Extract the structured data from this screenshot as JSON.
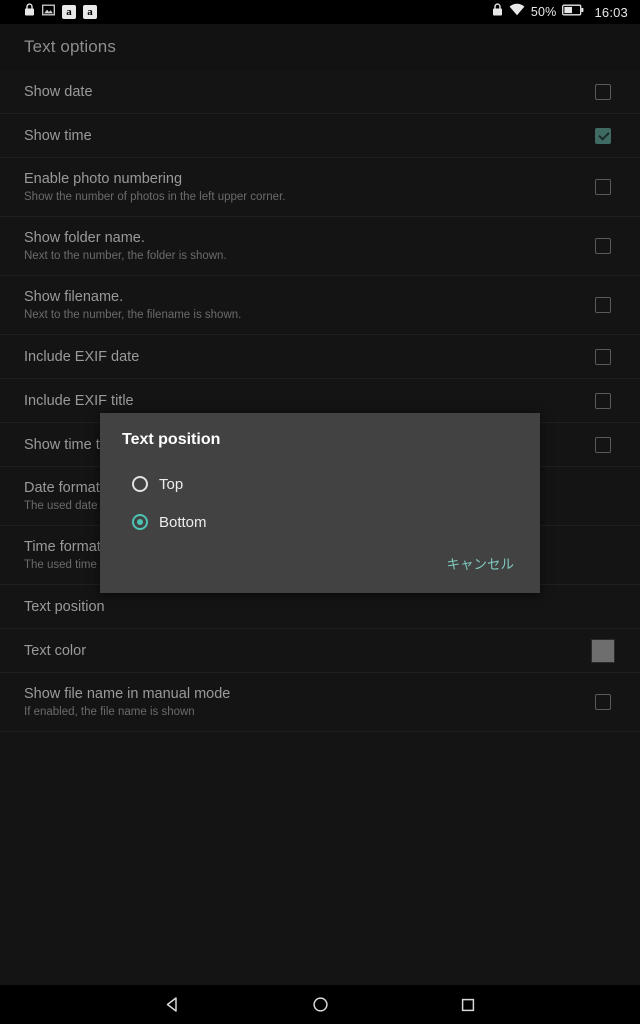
{
  "status_bar": {
    "left_icons": [
      "lock-icon",
      "image-icon",
      "amazon-icon",
      "amazon-icon"
    ],
    "amazon_glyph": "a",
    "right": {
      "lock_icon": "lock-icon",
      "wifi_icon": "wifi-icon",
      "battery_percent": "50%",
      "battery_icon": "battery-half-icon",
      "clock": "16:03"
    }
  },
  "toolbar": {
    "title": "Text options"
  },
  "preferences": [
    {
      "title": "Show date",
      "summary": "",
      "widget": "checkbox",
      "checked": false
    },
    {
      "title": "Show time",
      "summary": "",
      "widget": "checkbox",
      "checked": true
    },
    {
      "title": "Enable photo numbering",
      "summary": "Show the number of photos in the left upper corner.",
      "widget": "checkbox",
      "checked": false
    },
    {
      "title": "Show folder name.",
      "summary": "Next to the number, the folder is shown.",
      "widget": "checkbox",
      "checked": false
    },
    {
      "title": "Show filename.",
      "summary": "Next to the number, the filename is shown.",
      "widget": "checkbox",
      "checked": false
    },
    {
      "title": "Include EXIF date",
      "summary": "",
      "widget": "checkbox",
      "checked": false
    },
    {
      "title": "Include EXIF title",
      "summary": "",
      "widget": "checkbox",
      "checked": false
    },
    {
      "title": "Show time til",
      "summary": "",
      "widget": "checkbox",
      "checked": false
    },
    {
      "title": "Date format",
      "summary": "The used date f",
      "widget": "none",
      "checked": false
    },
    {
      "title": "Time format",
      "summary": "The used time f",
      "widget": "none",
      "checked": false
    },
    {
      "title": "Text position",
      "summary": "",
      "widget": "none",
      "checked": false
    },
    {
      "title": "Text color",
      "summary": "",
      "widget": "swatch",
      "checked": false,
      "swatch_color": "#6e6e6e"
    },
    {
      "title": "Show file name in manual mode",
      "summary": "If enabled, the file name is shown",
      "widget": "checkbox",
      "checked": false
    }
  ],
  "dialog": {
    "title": "Text position",
    "options": [
      {
        "label": "Top",
        "selected": false
      },
      {
        "label": "Bottom",
        "selected": true
      }
    ],
    "cancel_label": "キャンセル"
  },
  "nav_bar": {
    "back": "back-triangle-icon",
    "home": "home-circle-icon",
    "recents": "recents-square-icon"
  },
  "colors": {
    "accent_teal": "#4ec3b4",
    "cancel_teal": "#7fc9bf",
    "checkbox_checked": "#3f6b64",
    "dialog_bg": "#424242",
    "list_bg": "#141414"
  }
}
